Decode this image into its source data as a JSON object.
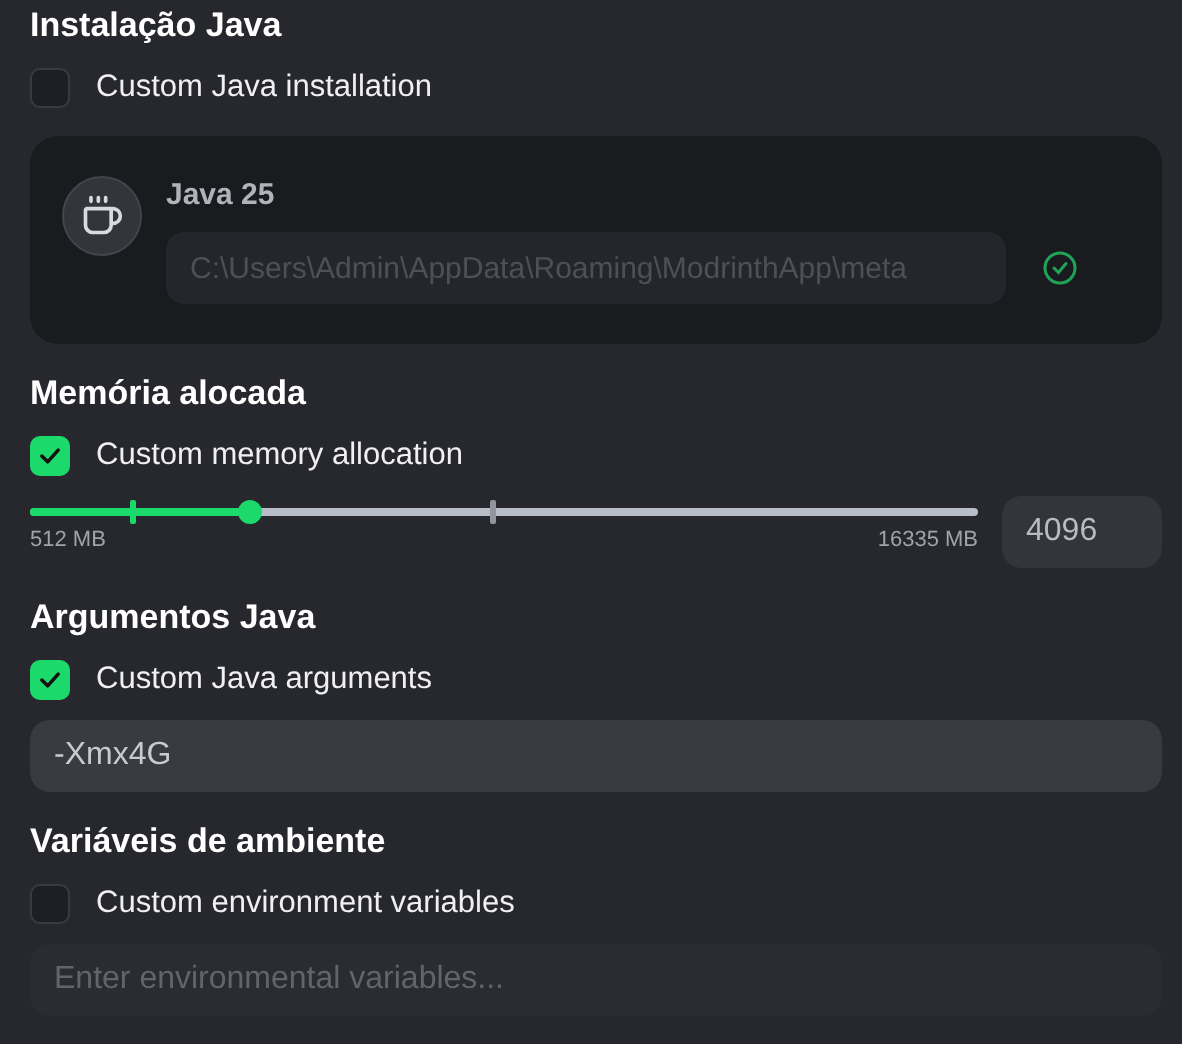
{
  "sections": [
    {
      "kind": "java",
      "title": "Instalação Java",
      "checkbox": {
        "label": "Custom Java installation",
        "checked": false
      },
      "java": {
        "name": "Java 25",
        "path": "C:\\Users\\Admin\\AppData\\Roaming\\ModrinthApp\\meta"
      }
    },
    {
      "kind": "memory",
      "title": "Memória alocada",
      "checkbox": {
        "label": "Custom memory allocation",
        "checked": true
      },
      "slider": {
        "level": 0.232,
        "min_label": "512 MB",
        "max_label": "16335 MB",
        "value": "4096"
      }
    },
    {
      "kind": "text",
      "title": "Argumentos Java",
      "checkbox": {
        "label": "Custom Java arguments",
        "checked": true
      },
      "field": {
        "value": "-Xmx4G",
        "disabled": false
      }
    },
    {
      "kind": "text",
      "title": "Variáveis de ambiente",
      "checkbox": {
        "label": "Custom environment variables",
        "checked": false
      },
      "field": {
        "placeholder": "Enter environmental variables...",
        "disabled": true
      }
    }
  ]
}
